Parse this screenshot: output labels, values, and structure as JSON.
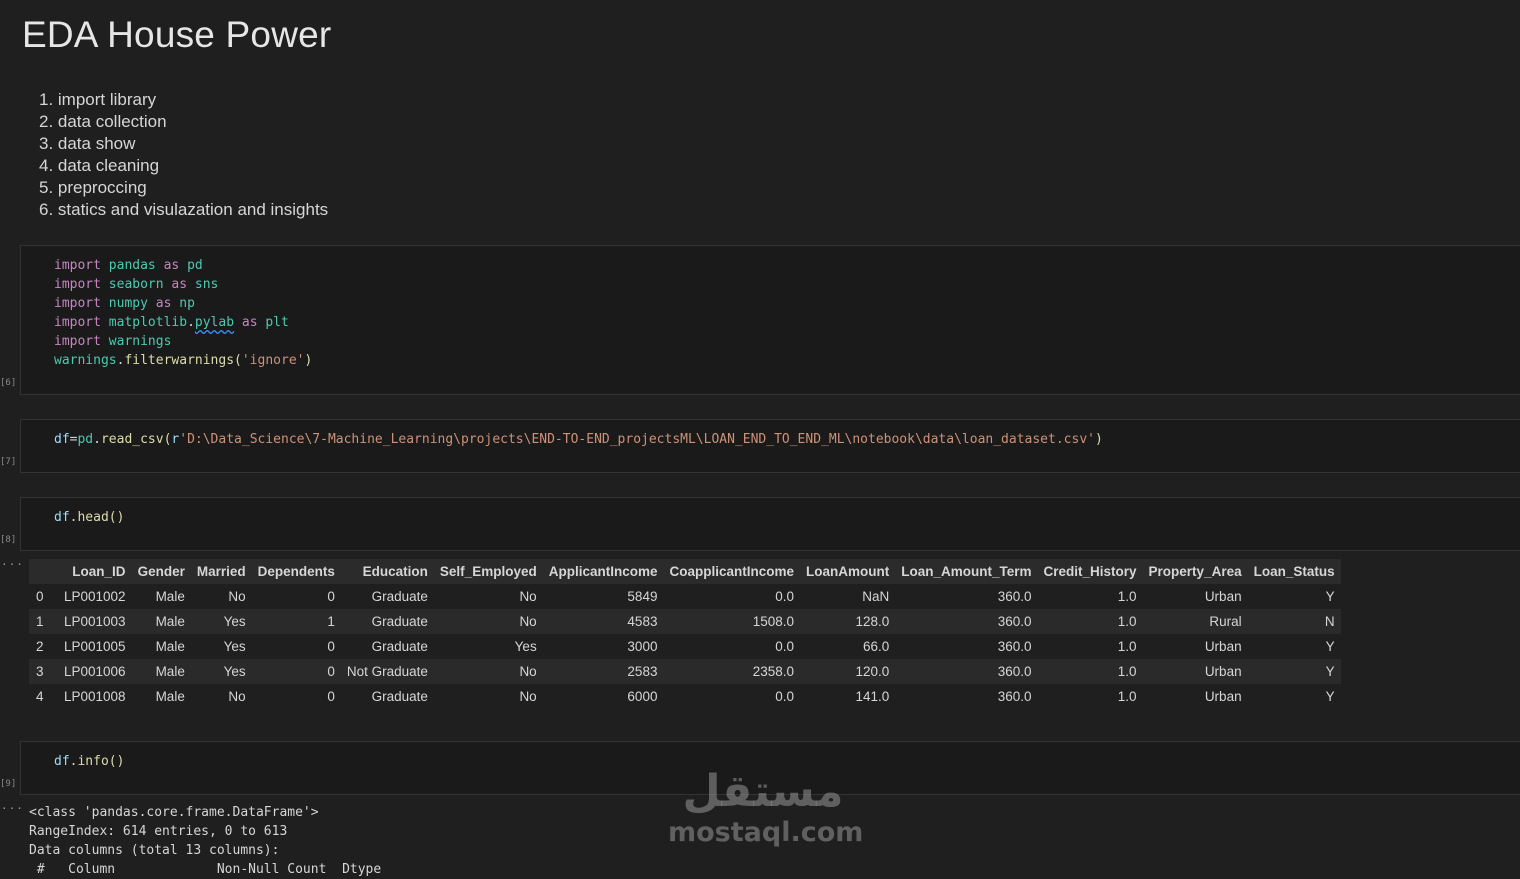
{
  "markdown": {
    "title": "EDA House Power",
    "steps": [
      "1. import library",
      "2. data collection",
      "3. data show",
      "4. data cleaning",
      "5. preproccing",
      "6. statics and visulazation and insights"
    ]
  },
  "cells": [
    {
      "exec_count": "[6]",
      "code": [
        "import pandas as pd",
        "import seaborn as sns",
        "import numpy as np",
        "import matplotlib.pylab as plt",
        "import warnings",
        "warnings.filterwarnings('ignore')"
      ]
    },
    {
      "exec_count": "[7]",
      "code": [
        "df=pd.read_csv(r'D:\\Data_Science\\7-Machine_Learning\\projects\\END-TO-END_projectsML\\LOAN_END_TO_END_ML\\notebook\\data\\loan_dataset.csv')"
      ]
    },
    {
      "exec_count": "[8]",
      "code": [
        "df.head()"
      ]
    },
    {
      "exec_count": "[9]",
      "code": [
        "df.info()"
      ]
    }
  ],
  "output_marker": "...",
  "dataframe": {
    "columns": [
      "",
      "Loan_ID",
      "Gender",
      "Married",
      "Dependents",
      "Education",
      "Self_Employed",
      "ApplicantIncome",
      "CoapplicantIncome",
      "LoanAmount",
      "Loan_Amount_Term",
      "Credit_History",
      "Property_Area",
      "Loan_Status"
    ],
    "rows": [
      [
        "0",
        "LP001002",
        "Male",
        "No",
        "0",
        "Graduate",
        "No",
        "5849",
        "0.0",
        "NaN",
        "360.0",
        "1.0",
        "Urban",
        "Y"
      ],
      [
        "1",
        "LP001003",
        "Male",
        "Yes",
        "1",
        "Graduate",
        "No",
        "4583",
        "1508.0",
        "128.0",
        "360.0",
        "1.0",
        "Rural",
        "N"
      ],
      [
        "2",
        "LP001005",
        "Male",
        "Yes",
        "0",
        "Graduate",
        "Yes",
        "3000",
        "0.0",
        "66.0",
        "360.0",
        "1.0",
        "Urban",
        "Y"
      ],
      [
        "3",
        "LP001006",
        "Male",
        "Yes",
        "0",
        "Not Graduate",
        "No",
        "2583",
        "2358.0",
        "120.0",
        "360.0",
        "1.0",
        "Urban",
        "Y"
      ],
      [
        "4",
        "LP001008",
        "Male",
        "No",
        "0",
        "Graduate",
        "No",
        "6000",
        "0.0",
        "141.0",
        "360.0",
        "1.0",
        "Urban",
        "Y"
      ]
    ]
  },
  "info_output": [
    "<class 'pandas.core.frame.DataFrame'>",
    "RangeIndex: 614 entries, 0 to 613",
    "Data columns (total 13 columns):",
    " #   Column             Non-Null Count  Dtype"
  ],
  "watermark": {
    "arabic": "مستقل",
    "latin": "mostaql.com"
  },
  "colors": {
    "background": "#1f1f1f",
    "cell_background": "#1a1a1a",
    "keyword": "#c586c0",
    "module": "#4ec9b0",
    "variable": "#9cdcfe",
    "function": "#dcdcaa",
    "string": "#ce9178"
  }
}
